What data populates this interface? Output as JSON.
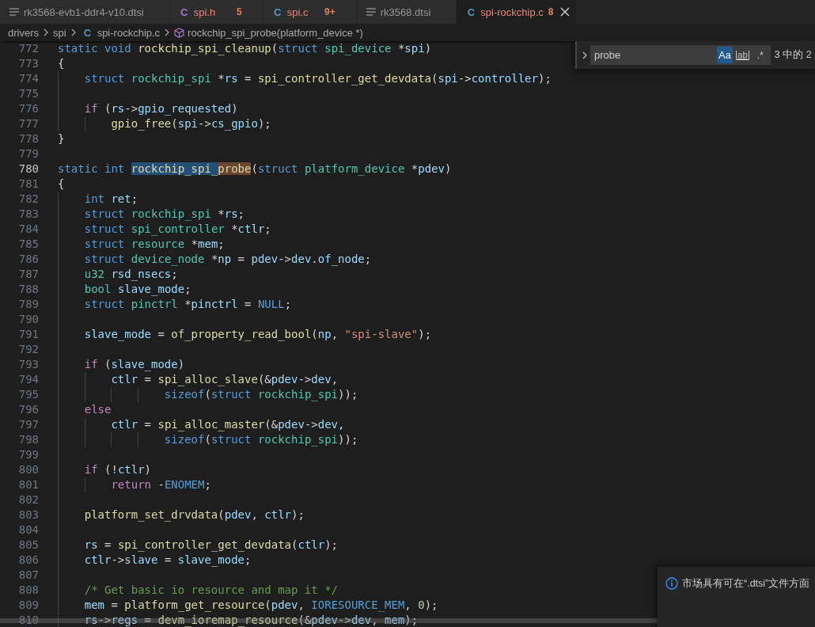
{
  "tabs": [
    {
      "kind": "devicetree",
      "label": "rk3568-evb1-ddr4-v10.dtsi",
      "has_problems": false,
      "selected": false
    },
    {
      "kind": "header",
      "glyph": "C",
      "label": "spi.h",
      "badge": "5",
      "has_problems": true,
      "selected": false
    },
    {
      "kind": "source",
      "glyph": "C",
      "label": "spi.c",
      "badge": "9+",
      "has_problems": true,
      "selected": false
    },
    {
      "kind": "devicetree",
      "label": "rk3568.dtsi",
      "has_problems": false,
      "selected": false
    },
    {
      "kind": "source",
      "glyph": "C",
      "label": "spi-rockchip.c",
      "badge": "8",
      "has_problems": true,
      "selected": true
    }
  ],
  "breadcrumbs": [
    {
      "kind": "folder",
      "label": "drivers"
    },
    {
      "kind": "folder",
      "label": "spi"
    },
    {
      "kind": "file",
      "glyph": "C",
      "label": "spi-rockchip.c"
    },
    {
      "kind": "symbol",
      "label": "rockchip_spi_probe(platform_device *)"
    }
  ],
  "find": {
    "value": "probe",
    "options": [
      {
        "kind": "case",
        "label": "Aa",
        "selected": true
      },
      {
        "kind": "word",
        "label": "ab",
        "selected": false
      },
      {
        "kind": "regex",
        "label": ".*",
        "selected": false
      }
    ],
    "result": "3 中的 2"
  },
  "editor": {
    "lines": [
      {
        "number": "772",
        "current": false,
        "tokens": [
          {
            "kind": "keyword",
            "text": "static "
          },
          {
            "kind": "keyword",
            "text": "void "
          },
          {
            "kind": "function",
            "text": "rockchip_spi_cleanup"
          },
          {
            "kind": "plain",
            "text": "("
          },
          {
            "kind": "keyword",
            "text": "struct "
          },
          {
            "kind": "type",
            "text": "spi_device"
          },
          {
            "kind": "plain",
            "text": " *"
          },
          {
            "kind": "variable",
            "text": "spi"
          },
          {
            "kind": "plain",
            "text": ")"
          }
        ]
      },
      {
        "number": "773",
        "current": false,
        "tokens": [
          {
            "kind": "plain",
            "text": "{"
          }
        ]
      },
      {
        "number": "774",
        "current": false,
        "tokens": [
          {
            "kind": "keyword",
            "text": "    struct "
          },
          {
            "kind": "type",
            "text": "rockchip_spi"
          },
          {
            "kind": "plain",
            "text": " *"
          },
          {
            "kind": "variable",
            "text": "rs"
          },
          {
            "kind": "plain",
            "text": " = "
          },
          {
            "kind": "function",
            "text": "spi_controller_get_devdata"
          },
          {
            "kind": "plain",
            "text": "("
          },
          {
            "kind": "variable",
            "text": "spi"
          },
          {
            "kind": "plain",
            "text": "->"
          },
          {
            "kind": "variable",
            "text": "controller"
          },
          {
            "kind": "plain",
            "text": ");"
          }
        ]
      },
      {
        "number": "775",
        "current": false
      },
      {
        "number": "776",
        "current": false,
        "tokens": [
          {
            "kind": "control",
            "text": "    if"
          },
          {
            "kind": "plain",
            "text": " ("
          },
          {
            "kind": "variable",
            "text": "rs"
          },
          {
            "kind": "plain",
            "text": "->"
          },
          {
            "kind": "variable",
            "text": "gpio_requested"
          },
          {
            "kind": "plain",
            "text": ")"
          }
        ]
      },
      {
        "number": "777",
        "current": false,
        "tokens": [
          {
            "kind": "function",
            "text": "        gpio_free"
          },
          {
            "kind": "plain",
            "text": "("
          },
          {
            "kind": "variable",
            "text": "spi"
          },
          {
            "kind": "plain",
            "text": "->"
          },
          {
            "kind": "variable",
            "text": "cs_gpio"
          },
          {
            "kind": "plain",
            "text": ");"
          }
        ]
      },
      {
        "number": "778",
        "current": false,
        "tokens": [
          {
            "kind": "plain",
            "text": "}"
          }
        ]
      },
      {
        "number": "779",
        "current": false
      },
      {
        "number": "780",
        "current": true,
        "tokens": [
          {
            "kind": "keyword",
            "text": "static "
          },
          {
            "kind": "keyword",
            "text": "int "
          },
          {
            "kind": "function",
            "text": "rockchip_spi_",
            "in_selection": true
          },
          {
            "kind": "function",
            "text": "probe",
            "in_selection": true,
            "find_match": true
          },
          {
            "kind": "plain",
            "text": "("
          },
          {
            "kind": "keyword",
            "text": "struct "
          },
          {
            "kind": "type",
            "text": "platform_device"
          },
          {
            "kind": "plain",
            "text": " *"
          },
          {
            "kind": "variable",
            "text": "pdev"
          },
          {
            "kind": "plain",
            "text": ")"
          }
        ]
      },
      {
        "number": "781",
        "current": false,
        "tokens": [
          {
            "kind": "plain",
            "text": "{"
          }
        ]
      },
      {
        "number": "782",
        "current": false,
        "tokens": [
          {
            "kind": "keyword",
            "text": "    int "
          },
          {
            "kind": "variable",
            "text": "ret"
          },
          {
            "kind": "plain",
            "text": ";"
          }
        ]
      },
      {
        "number": "783",
        "current": false,
        "tokens": [
          {
            "kind": "keyword",
            "text": "    struct "
          },
          {
            "kind": "type",
            "text": "rockchip_spi"
          },
          {
            "kind": "plain",
            "text": " *"
          },
          {
            "kind": "variable",
            "text": "rs"
          },
          {
            "kind": "plain",
            "text": ";"
          }
        ]
      },
      {
        "number": "784",
        "current": false,
        "tokens": [
          {
            "kind": "keyword",
            "text": "    struct "
          },
          {
            "kind": "type",
            "text": "spi_controller"
          },
          {
            "kind": "plain",
            "text": " *"
          },
          {
            "kind": "variable",
            "text": "ctlr"
          },
          {
            "kind": "plain",
            "text": ";"
          }
        ]
      },
      {
        "number": "785",
        "current": false,
        "tokens": [
          {
            "kind": "keyword",
            "text": "    struct "
          },
          {
            "kind": "type",
            "text": "resource"
          },
          {
            "kind": "plain",
            "text": " *"
          },
          {
            "kind": "variable",
            "text": "mem"
          },
          {
            "kind": "plain",
            "text": ";"
          }
        ]
      },
      {
        "number": "786",
        "current": false,
        "tokens": [
          {
            "kind": "keyword",
            "text": "    struct "
          },
          {
            "kind": "type",
            "text": "device_node"
          },
          {
            "kind": "plain",
            "text": " *"
          },
          {
            "kind": "variable",
            "text": "np"
          },
          {
            "kind": "plain",
            "text": " = "
          },
          {
            "kind": "variable",
            "text": "pdev"
          },
          {
            "kind": "plain",
            "text": "->"
          },
          {
            "kind": "variable",
            "text": "dev"
          },
          {
            "kind": "plain",
            "text": "."
          },
          {
            "kind": "variable",
            "text": "of_node"
          },
          {
            "kind": "plain",
            "text": ";"
          }
        ]
      },
      {
        "number": "787",
        "current": false,
        "tokens": [
          {
            "kind": "type",
            "text": "    u32 "
          },
          {
            "kind": "variable",
            "text": "rsd_nsecs"
          },
          {
            "kind": "plain",
            "text": ";"
          }
        ]
      },
      {
        "number": "788",
        "current": false,
        "tokens": [
          {
            "kind": "type",
            "text": "    bool "
          },
          {
            "kind": "variable",
            "text": "slave_mode"
          },
          {
            "kind": "plain",
            "text": ";"
          }
        ]
      },
      {
        "number": "789",
        "current": false,
        "tokens": [
          {
            "kind": "keyword",
            "text": "    struct "
          },
          {
            "kind": "type",
            "text": "pinctrl"
          },
          {
            "kind": "plain",
            "text": " *"
          },
          {
            "kind": "variable",
            "text": "pinctrl"
          },
          {
            "kind": "plain",
            "text": " = "
          },
          {
            "kind": "macro",
            "text": "NULL"
          },
          {
            "kind": "plain",
            "text": ";"
          }
        ]
      },
      {
        "number": "790",
        "current": false
      },
      {
        "number": "791",
        "current": false,
        "tokens": [
          {
            "kind": "variable",
            "text": "    slave_mode"
          },
          {
            "kind": "plain",
            "text": " = "
          },
          {
            "kind": "function",
            "text": "of_property_read_bool"
          },
          {
            "kind": "plain",
            "text": "("
          },
          {
            "kind": "variable",
            "text": "np"
          },
          {
            "kind": "plain",
            "text": ", "
          },
          {
            "kind": "string",
            "text": "\"spi-slave\""
          },
          {
            "kind": "plain",
            "text": ");"
          }
        ]
      },
      {
        "number": "792",
        "current": false
      },
      {
        "number": "793",
        "current": false,
        "tokens": [
          {
            "kind": "control",
            "text": "    if"
          },
          {
            "kind": "plain",
            "text": " ("
          },
          {
            "kind": "variable",
            "text": "slave_mode"
          },
          {
            "kind": "plain",
            "text": ")"
          }
        ]
      },
      {
        "number": "794",
        "current": false,
        "tokens": [
          {
            "kind": "variable",
            "text": "        ctlr"
          },
          {
            "kind": "plain",
            "text": " = "
          },
          {
            "kind": "function",
            "text": "spi_alloc_slave"
          },
          {
            "kind": "plain",
            "text": "(&"
          },
          {
            "kind": "variable",
            "text": "pdev"
          },
          {
            "kind": "plain",
            "text": "->"
          },
          {
            "kind": "variable",
            "text": "dev"
          },
          {
            "kind": "plain",
            "text": ","
          }
        ]
      },
      {
        "number": "795",
        "current": false,
        "tokens": [
          {
            "kind": "keyword",
            "text": "                sizeof"
          },
          {
            "kind": "plain",
            "text": "("
          },
          {
            "kind": "keyword",
            "text": "struct "
          },
          {
            "kind": "type",
            "text": "rockchip_spi"
          },
          {
            "kind": "plain",
            "text": "));"
          }
        ]
      },
      {
        "number": "796",
        "current": false,
        "tokens": [
          {
            "kind": "control",
            "text": "    else"
          }
        ]
      },
      {
        "number": "797",
        "current": false,
        "tokens": [
          {
            "kind": "variable",
            "text": "        ctlr"
          },
          {
            "kind": "plain",
            "text": " = "
          },
          {
            "kind": "function",
            "text": "spi_alloc_master"
          },
          {
            "kind": "plain",
            "text": "(&"
          },
          {
            "kind": "variable",
            "text": "pdev"
          },
          {
            "kind": "plain",
            "text": "->"
          },
          {
            "kind": "variable",
            "text": "dev"
          },
          {
            "kind": "plain",
            "text": ","
          }
        ]
      },
      {
        "number": "798",
        "current": false,
        "tokens": [
          {
            "kind": "keyword",
            "text": "                sizeof"
          },
          {
            "kind": "plain",
            "text": "("
          },
          {
            "kind": "keyword",
            "text": "struct "
          },
          {
            "kind": "type",
            "text": "rockchip_spi"
          },
          {
            "kind": "plain",
            "text": "));"
          }
        ]
      },
      {
        "number": "799",
        "current": false
      },
      {
        "number": "800",
        "current": false,
        "tokens": [
          {
            "kind": "control",
            "text": "    if"
          },
          {
            "kind": "plain",
            "text": " (!"
          },
          {
            "kind": "variable",
            "text": "ctlr"
          },
          {
            "kind": "plain",
            "text": ")"
          }
        ]
      },
      {
        "number": "801",
        "current": false,
        "tokens": [
          {
            "kind": "control",
            "text": "        return"
          },
          {
            "kind": "plain",
            "text": " -"
          },
          {
            "kind": "macro",
            "text": "ENOMEM"
          },
          {
            "kind": "plain",
            "text": ";"
          }
        ]
      },
      {
        "number": "802",
        "current": false
      },
      {
        "number": "803",
        "current": false,
        "tokens": [
          {
            "kind": "function",
            "text": "    platform_set_drvdata"
          },
          {
            "kind": "plain",
            "text": "("
          },
          {
            "kind": "variable",
            "text": "pdev"
          },
          {
            "kind": "plain",
            "text": ", "
          },
          {
            "kind": "variable",
            "text": "ctlr"
          },
          {
            "kind": "plain",
            "text": ");"
          }
        ]
      },
      {
        "number": "804",
        "current": false
      },
      {
        "number": "805",
        "current": false,
        "tokens": [
          {
            "kind": "variable",
            "text": "    rs"
          },
          {
            "kind": "plain",
            "text": " = "
          },
          {
            "kind": "function",
            "text": "spi_controller_get_devdata"
          },
          {
            "kind": "plain",
            "text": "("
          },
          {
            "kind": "variable",
            "text": "ctlr"
          },
          {
            "kind": "plain",
            "text": ");"
          }
        ]
      },
      {
        "number": "806",
        "current": false,
        "tokens": [
          {
            "kind": "variable",
            "text": "    ctlr"
          },
          {
            "kind": "plain",
            "text": "->"
          },
          {
            "kind": "variable",
            "text": "slave"
          },
          {
            "kind": "plain",
            "text": " = "
          },
          {
            "kind": "variable",
            "text": "slave_mode"
          },
          {
            "kind": "plain",
            "text": ";"
          }
        ]
      },
      {
        "number": "807",
        "current": false
      },
      {
        "number": "808",
        "current": false,
        "tokens": [
          {
            "kind": "comment",
            "text": "    /* Get basic io resource and map it */"
          }
        ]
      },
      {
        "number": "809",
        "current": false,
        "tokens": [
          {
            "kind": "variable",
            "text": "    mem"
          },
          {
            "kind": "plain",
            "text": " = "
          },
          {
            "kind": "function",
            "text": "platform_get_resource"
          },
          {
            "kind": "plain",
            "text": "("
          },
          {
            "kind": "variable",
            "text": "pdev"
          },
          {
            "kind": "plain",
            "text": ", "
          },
          {
            "kind": "macro",
            "text": "IORESOURCE_MEM"
          },
          {
            "kind": "plain",
            "text": ", "
          },
          {
            "kind": "number",
            "text": "0"
          },
          {
            "kind": "plain",
            "text": ");"
          }
        ]
      },
      {
        "number": "810",
        "current": false,
        "tokens": [
          {
            "kind": "variable",
            "text": "    rs"
          },
          {
            "kind": "plain",
            "text": "->"
          },
          {
            "kind": "variable",
            "text": "regs"
          },
          {
            "kind": "plain",
            "text": " = "
          },
          {
            "kind": "function",
            "text": "devm_ioremap_resource"
          },
          {
            "kind": "plain",
            "text": "(&"
          },
          {
            "kind": "variable",
            "text": "pdev"
          },
          {
            "kind": "plain",
            "text": "->"
          },
          {
            "kind": "variable",
            "text": "dev"
          },
          {
            "kind": "plain",
            "text": ", "
          },
          {
            "kind": "variable",
            "text": "mem"
          },
          {
            "kind": "plain",
            "text": ");"
          }
        ]
      }
    ]
  },
  "notification": {
    "kind": "info",
    "message": "市场具有可在“.dtsi”文件方面"
  }
}
